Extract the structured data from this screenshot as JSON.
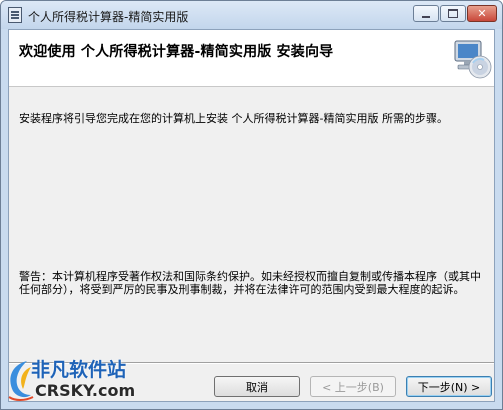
{
  "window": {
    "title": "个人所得税计算器-精简实用版"
  },
  "banner": {
    "title": "欢迎使用 个人所得税计算器-精简实用版 安装向导",
    "icon": "setup-computer-cd-icon"
  },
  "body": {
    "intro": "安装程序将引导您完成在您的计算机上安装 个人所得税计算器-精简实用版 所需的步骤。",
    "warning": "警告：本计算机程序受著作权法和国际条约保护。如未经授权而擅自复制或传播本程序（或其中任何部分），将受到严厉的民事及刑事制裁，并将在法律许可的范围内受到最大程度的起诉。"
  },
  "buttons": {
    "cancel": "取消",
    "back": "< 上一步(B)",
    "next": "下一步(N) >"
  },
  "watermark": {
    "cn": "非凡软件站",
    "en": "CRSKY.com"
  },
  "colors": {
    "title_bar": "#c3d6ec",
    "close_button": "#c8473a",
    "client_background": "#f0f0f0",
    "watermark_blue": "#1e63b8"
  }
}
